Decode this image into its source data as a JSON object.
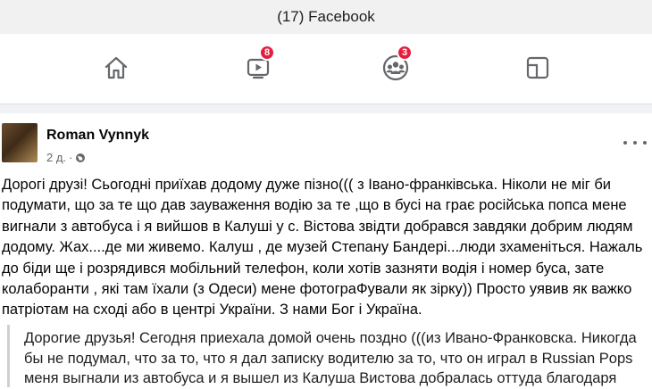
{
  "window": {
    "title": "(17) Facebook"
  },
  "nav": {
    "home_icon": "home-icon",
    "watch_icon": "video-icon",
    "watch_badge": "8",
    "groups_icon": "groups-icon",
    "groups_badge": "3",
    "gaming_icon": "gaming-icon"
  },
  "post": {
    "author": "Roman Vynnyk",
    "time": "2 д.",
    "privacy_icon": "globe-icon",
    "more_icon": "more-icon",
    "text": "Дорогі друзі! Сьогодні приїхав додому дуже пізно((( з Івано-франківська. Ніколи не міг би\nподумати, що за те що дав зауваження водію за те ,що в бусі на грає російська попса мене\nвигнали з автобуса і я вийшов в Калуші у с. Вістова звідти добрався завдяки добрим людям\nдодому. Жах....де ми живемо. Калуш , де музей Степану Бандері...люди зхаменіться. Нажаль\nдо біди ще і розрядився мобільний телефон, коли хотів зазняти водія і номер буса, зате\nколаборанти , які там їхали (з Одеси)  мене фотограФували як зірку)) Просто уявив як важко\nпатріотам на сході або в центрі України. З нами Бог і Україна.",
    "translation": "Дорогие друзья! Сегодня приехала домой очень поздно (((из Ивано-Франковска. Никогда\nбы не подумал, что за то, что я дал записку водителю за то, что он играл в Russian Pops\nменя выгнали из автобуса и я вышел из Калуша Вистова добралась оттуда благодаря"
  },
  "colors": {
    "badge": "#e41e3f",
    "icon": "#65676b"
  }
}
